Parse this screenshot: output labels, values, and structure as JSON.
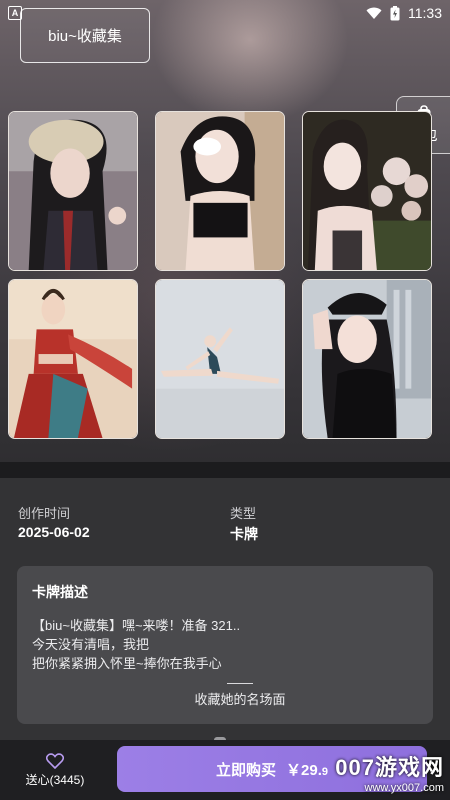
{
  "status_bar": {
    "time": "11:33",
    "notification_letter": "A"
  },
  "header": {
    "collection_label": "biu~收藏集"
  },
  "side_button": {
    "label": "背包",
    "icon": "backpack-icon"
  },
  "cards": [
    {
      "name": "card-1",
      "desc": "photo-girl-bear-hat"
    },
    {
      "name": "card-2",
      "desc": "photo-girl-eyepatch"
    },
    {
      "name": "card-3",
      "desc": "photo-girl-flowers"
    },
    {
      "name": "card-4",
      "desc": "photo-dancer-red-costume"
    },
    {
      "name": "card-5",
      "desc": "photo-ballet-split"
    },
    {
      "name": "card-6",
      "desc": "photo-girl-black-cap"
    }
  ],
  "meta": {
    "created_label": "创作时间",
    "created_value": "2025-06-02",
    "type_label": "类型",
    "type_value": "卡牌"
  },
  "description": {
    "title": "卡牌描述",
    "line1": "【biu~收藏集】嘿~来喽！准备 321..",
    "line2": "今天没有清唱，我把",
    "line3": "把你紧紧拥入怀里~捧你在我手心",
    "dash": "——",
    "signature": "收藏她的名场面"
  },
  "footer": {
    "like_label": "送心(3445)",
    "buy_label": "立即购买",
    "price_symbol": "￥",
    "price_int": "29.",
    "price_dec": "9"
  },
  "watermark": {
    "main": "007游戏网",
    "url": "www.yx007.com"
  },
  "colors": {
    "buy_button": "#9c7fe6",
    "background": "#333335"
  }
}
